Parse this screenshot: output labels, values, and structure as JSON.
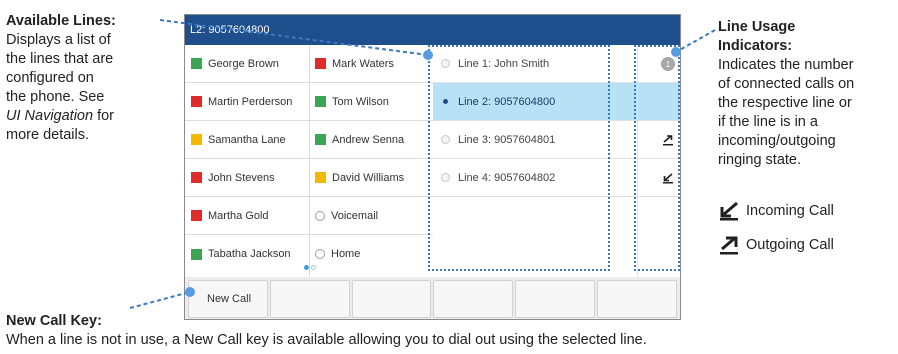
{
  "annotations": {
    "lines": {
      "title": "Available Lines:",
      "text1": "Displays a list of",
      "text2": "the lines that are",
      "text3": "configured on",
      "text4": "the phone. See",
      "text5_italic": "UI Navigation",
      "text5_rest": " for",
      "text6": "more details."
    },
    "indicators": {
      "title1": "Line Usage",
      "title2": "Indicators:",
      "text1": "Indicates the number",
      "text2": "of connected calls on",
      "text3": "the respective line or",
      "text4": "if the line is in a",
      "text5": "incoming/outgoing",
      "text6": "ringing state.",
      "incoming_label": "Incoming Call",
      "outgoing_label": "Outgoing Call"
    },
    "new_call": {
      "title": "New Call Key:",
      "text": "When a line is not in use, a New Call key is available allowing you to dial out using the selected line."
    }
  },
  "screen": {
    "title": "L2: 9057604800",
    "contacts_left": [
      {
        "name": "George Brown",
        "color": "#3aa655"
      },
      {
        "name": "Martin Perderson",
        "color": "#e02b2b"
      },
      {
        "name": "Samantha Lane",
        "color": "#f5b800"
      },
      {
        "name": "John Stevens",
        "color": "#e02b2b"
      },
      {
        "name": "Martha Gold",
        "color": "#e02b2b"
      },
      {
        "name": "Tabatha Jackson",
        "color": "#3aa655"
      }
    ],
    "contacts_right": [
      {
        "name": "Mark Waters",
        "color": "#e02b2b"
      },
      {
        "name": "Tom Wilson",
        "color": "#3aa655"
      },
      {
        "name": "Andrew Senna",
        "color": "#3aa655"
      },
      {
        "name": "David Williams",
        "color": "#f5b800"
      },
      {
        "name": "Voicemail",
        "color": null
      },
      {
        "name": "Home",
        "color": null
      }
    ],
    "lines": [
      {
        "label": "Line 1: John Smith",
        "selected": false,
        "indicator": "count",
        "count": "1"
      },
      {
        "label": "Line 2: 9057604800",
        "selected": true,
        "indicator": "none"
      },
      {
        "label": "Line 3: 9057604801",
        "selected": false,
        "indicator": "outgoing-call-icon"
      },
      {
        "label": "Line 4: 9057604802",
        "selected": false,
        "indicator": "incoming-call-icon"
      }
    ],
    "softkeys": [
      "New Call",
      "",
      "",
      "",
      "",
      ""
    ],
    "page_dots": {
      "count": 2,
      "active": 1
    }
  },
  "colors": {
    "title_bar": "#1e4e8c",
    "selected_row": "#b9e1f6",
    "annotation_line": "#3a78c2"
  }
}
